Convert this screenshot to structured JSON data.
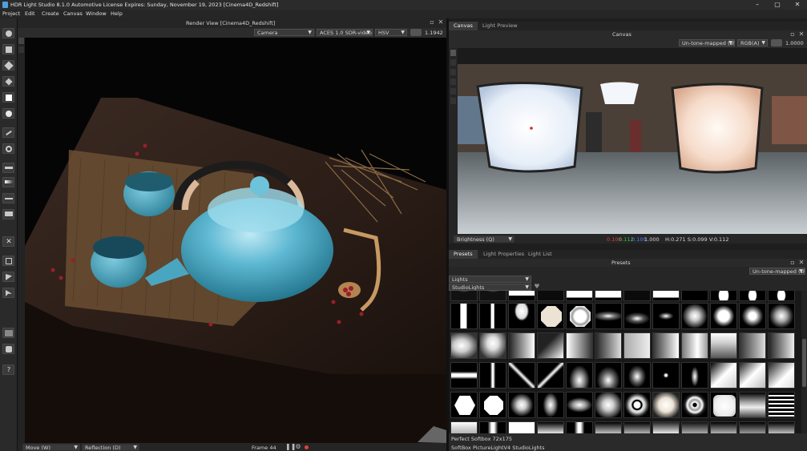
{
  "title_bar": {
    "title": "HDR Light Studio 8.1.0  Automotive License Expires: Sunday, November 19, 2023  [Cinema4D_Redshift]"
  },
  "menu": {
    "items": [
      "Project",
      "Edit",
      "Create",
      "Canvas",
      "Window",
      "Help"
    ]
  },
  "render_view": {
    "title": "Render View [Cinema4D_Redshift]",
    "camera": "Camera",
    "color_space": "ACES 1.0 SDR-video",
    "color_mode": "HSV",
    "exposure": "1.1942",
    "status": {
      "tool": "Move (W)",
      "mode": "Reflection (D)",
      "frame": "Frame 44"
    }
  },
  "canvas_panel": {
    "tabs": [
      "Canvas",
      "Light Preview"
    ],
    "title": "Canvas",
    "tone_mapping": "Un-tone-mapped (sR",
    "channels": "RGB(A)",
    "exposure": "1.0000",
    "status": {
      "probe": "Brightness (Q)",
      "r": "0.100",
      "g": "0.112",
      "b": "0.100",
      "a": "1.000",
      "hsv": "H:0.271 S:0.099 V:0.112"
    }
  },
  "presets_panel": {
    "tabs": [
      "Presets",
      "Light Properties",
      "Light List"
    ],
    "title": "Presets",
    "tone_mapping": "Un-tone-mapped (sR",
    "category": "Lights",
    "subcategory": "StudioLights",
    "selected_name": "Perfect Softbox 72x175",
    "collection": "SoftBox PictureLightV4 StudioLights"
  },
  "colors": {
    "accent": "#4aa3df",
    "panel": "#2a2a2a",
    "status_r": "#e04040",
    "status_g": "#40c040",
    "status_b": "#5080ff"
  }
}
